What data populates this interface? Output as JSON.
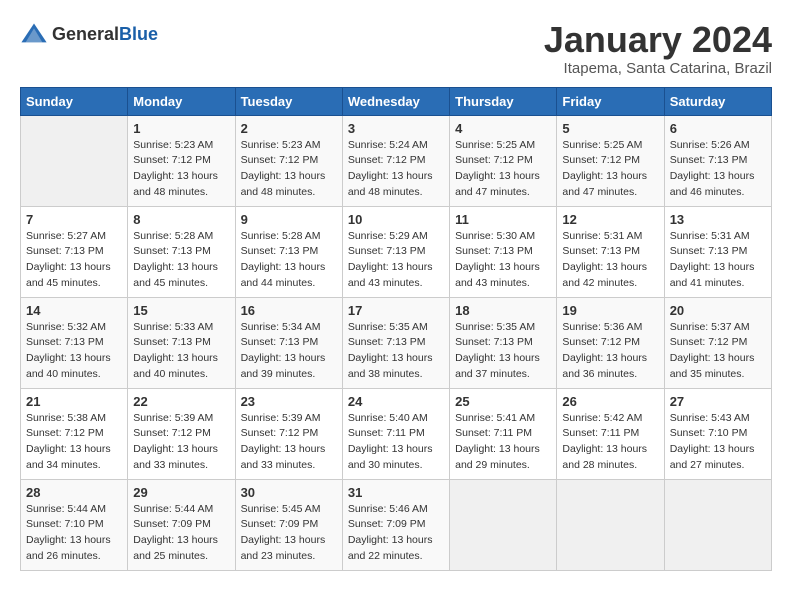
{
  "header": {
    "logo_general": "General",
    "logo_blue": "Blue",
    "title": "January 2024",
    "subtitle": "Itapema, Santa Catarina, Brazil"
  },
  "days_of_week": [
    "Sunday",
    "Monday",
    "Tuesday",
    "Wednesday",
    "Thursday",
    "Friday",
    "Saturday"
  ],
  "weeks": [
    [
      {
        "day": "",
        "info": ""
      },
      {
        "day": "1",
        "info": "Sunrise: 5:23 AM\nSunset: 7:12 PM\nDaylight: 13 hours\nand 48 minutes."
      },
      {
        "day": "2",
        "info": "Sunrise: 5:23 AM\nSunset: 7:12 PM\nDaylight: 13 hours\nand 48 minutes."
      },
      {
        "day": "3",
        "info": "Sunrise: 5:24 AM\nSunset: 7:12 PM\nDaylight: 13 hours\nand 48 minutes."
      },
      {
        "day": "4",
        "info": "Sunrise: 5:25 AM\nSunset: 7:12 PM\nDaylight: 13 hours\nand 47 minutes."
      },
      {
        "day": "5",
        "info": "Sunrise: 5:25 AM\nSunset: 7:12 PM\nDaylight: 13 hours\nand 47 minutes."
      },
      {
        "day": "6",
        "info": "Sunrise: 5:26 AM\nSunset: 7:13 PM\nDaylight: 13 hours\nand 46 minutes."
      }
    ],
    [
      {
        "day": "7",
        "info": "Sunrise: 5:27 AM\nSunset: 7:13 PM\nDaylight: 13 hours\nand 45 minutes."
      },
      {
        "day": "8",
        "info": "Sunrise: 5:28 AM\nSunset: 7:13 PM\nDaylight: 13 hours\nand 45 minutes."
      },
      {
        "day": "9",
        "info": "Sunrise: 5:28 AM\nSunset: 7:13 PM\nDaylight: 13 hours\nand 44 minutes."
      },
      {
        "day": "10",
        "info": "Sunrise: 5:29 AM\nSunset: 7:13 PM\nDaylight: 13 hours\nand 43 minutes."
      },
      {
        "day": "11",
        "info": "Sunrise: 5:30 AM\nSunset: 7:13 PM\nDaylight: 13 hours\nand 43 minutes."
      },
      {
        "day": "12",
        "info": "Sunrise: 5:31 AM\nSunset: 7:13 PM\nDaylight: 13 hours\nand 42 minutes."
      },
      {
        "day": "13",
        "info": "Sunrise: 5:31 AM\nSunset: 7:13 PM\nDaylight: 13 hours\nand 41 minutes."
      }
    ],
    [
      {
        "day": "14",
        "info": "Sunrise: 5:32 AM\nSunset: 7:13 PM\nDaylight: 13 hours\nand 40 minutes."
      },
      {
        "day": "15",
        "info": "Sunrise: 5:33 AM\nSunset: 7:13 PM\nDaylight: 13 hours\nand 40 minutes."
      },
      {
        "day": "16",
        "info": "Sunrise: 5:34 AM\nSunset: 7:13 PM\nDaylight: 13 hours\nand 39 minutes."
      },
      {
        "day": "17",
        "info": "Sunrise: 5:35 AM\nSunset: 7:13 PM\nDaylight: 13 hours\nand 38 minutes."
      },
      {
        "day": "18",
        "info": "Sunrise: 5:35 AM\nSunset: 7:13 PM\nDaylight: 13 hours\nand 37 minutes."
      },
      {
        "day": "19",
        "info": "Sunrise: 5:36 AM\nSunset: 7:12 PM\nDaylight: 13 hours\nand 36 minutes."
      },
      {
        "day": "20",
        "info": "Sunrise: 5:37 AM\nSunset: 7:12 PM\nDaylight: 13 hours\nand 35 minutes."
      }
    ],
    [
      {
        "day": "21",
        "info": "Sunrise: 5:38 AM\nSunset: 7:12 PM\nDaylight: 13 hours\nand 34 minutes."
      },
      {
        "day": "22",
        "info": "Sunrise: 5:39 AM\nSunset: 7:12 PM\nDaylight: 13 hours\nand 33 minutes."
      },
      {
        "day": "23",
        "info": "Sunrise: 5:39 AM\nSunset: 7:12 PM\nDaylight: 13 hours\nand 33 minutes."
      },
      {
        "day": "24",
        "info": "Sunrise: 5:40 AM\nSunset: 7:11 PM\nDaylight: 13 hours\nand 30 minutes."
      },
      {
        "day": "25",
        "info": "Sunrise: 5:41 AM\nSunset: 7:11 PM\nDaylight: 13 hours\nand 29 minutes."
      },
      {
        "day": "26",
        "info": "Sunrise: 5:42 AM\nSunset: 7:11 PM\nDaylight: 13 hours\nand 28 minutes."
      },
      {
        "day": "27",
        "info": "Sunrise: 5:43 AM\nSunset: 7:10 PM\nDaylight: 13 hours\nand 27 minutes."
      }
    ],
    [
      {
        "day": "28",
        "info": "Sunrise: 5:44 AM\nSunset: 7:10 PM\nDaylight: 13 hours\nand 26 minutes."
      },
      {
        "day": "29",
        "info": "Sunrise: 5:44 AM\nSunset: 7:09 PM\nDaylight: 13 hours\nand 25 minutes."
      },
      {
        "day": "30",
        "info": "Sunrise: 5:45 AM\nSunset: 7:09 PM\nDaylight: 13 hours\nand 23 minutes."
      },
      {
        "day": "31",
        "info": "Sunrise: 5:46 AM\nSunset: 7:09 PM\nDaylight: 13 hours\nand 22 minutes."
      },
      {
        "day": "",
        "info": ""
      },
      {
        "day": "",
        "info": ""
      },
      {
        "day": "",
        "info": ""
      }
    ]
  ]
}
